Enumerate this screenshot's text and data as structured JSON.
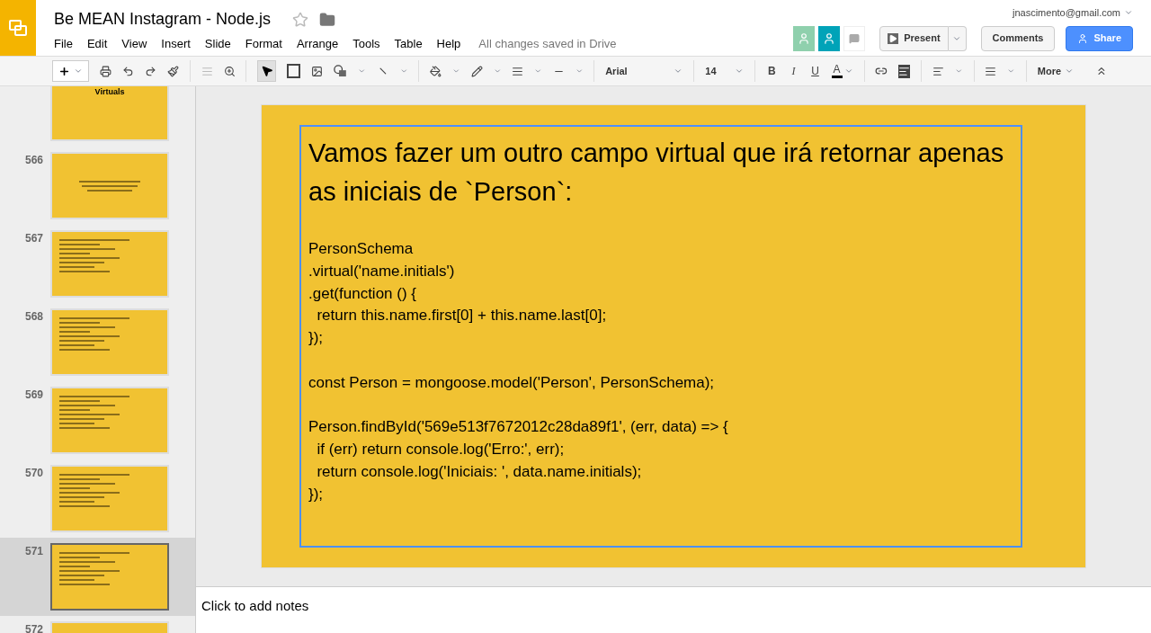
{
  "doc": {
    "title": "Be MEAN Instagram - Node.js",
    "starred": false,
    "save_status": "All changes saved in Drive",
    "account": "jnascimento@gmail.com"
  },
  "menu": [
    "File",
    "Edit",
    "View",
    "Insert",
    "Slide",
    "Format",
    "Arrange",
    "Tools",
    "Table",
    "Help"
  ],
  "header_buttons": {
    "present": "Present",
    "comments": "Comments",
    "share": "Share"
  },
  "toolbar": {
    "font": "Arial",
    "size": "14",
    "format": [
      "B",
      "I",
      "U",
      "A"
    ],
    "more": "More"
  },
  "slides": [
    {
      "title": "Virtuals",
      "selected": false,
      "kind": "title"
    },
    {
      "number": "566",
      "selected": false,
      "kind": "text"
    },
    {
      "number": "567",
      "selected": false,
      "kind": "code"
    },
    {
      "number": "568",
      "selected": false,
      "kind": "code"
    },
    {
      "number": "569",
      "selected": false,
      "kind": "code"
    },
    {
      "number": "570",
      "selected": false,
      "kind": "code"
    },
    {
      "number": "571",
      "selected": true,
      "kind": "code"
    },
    {
      "number": "572",
      "selected": false,
      "kind": "blank"
    }
  ],
  "slide": {
    "heading": "Vamos fazer um outro campo virtual que irá retornar apenas as iniciais de `Person`:",
    "code": [
      [
        "PersonSchema",
        ".virtual('name.initials')",
        ".get(function () {",
        "  return this.name.first[0] + this.name.last[0];",
        "});"
      ],
      [
        "const Person = mongoose.model('Person', PersonSchema);"
      ],
      [
        "Person.findById('569e513f7672012c28da89f1', (err, data) => {",
        "  if (err) return console.log('Erro:', err);",
        "  return console.log('Iniciais: ', data.name.initials);",
        "});"
      ]
    ]
  },
  "notes": {
    "placeholder": "Click to add notes"
  }
}
